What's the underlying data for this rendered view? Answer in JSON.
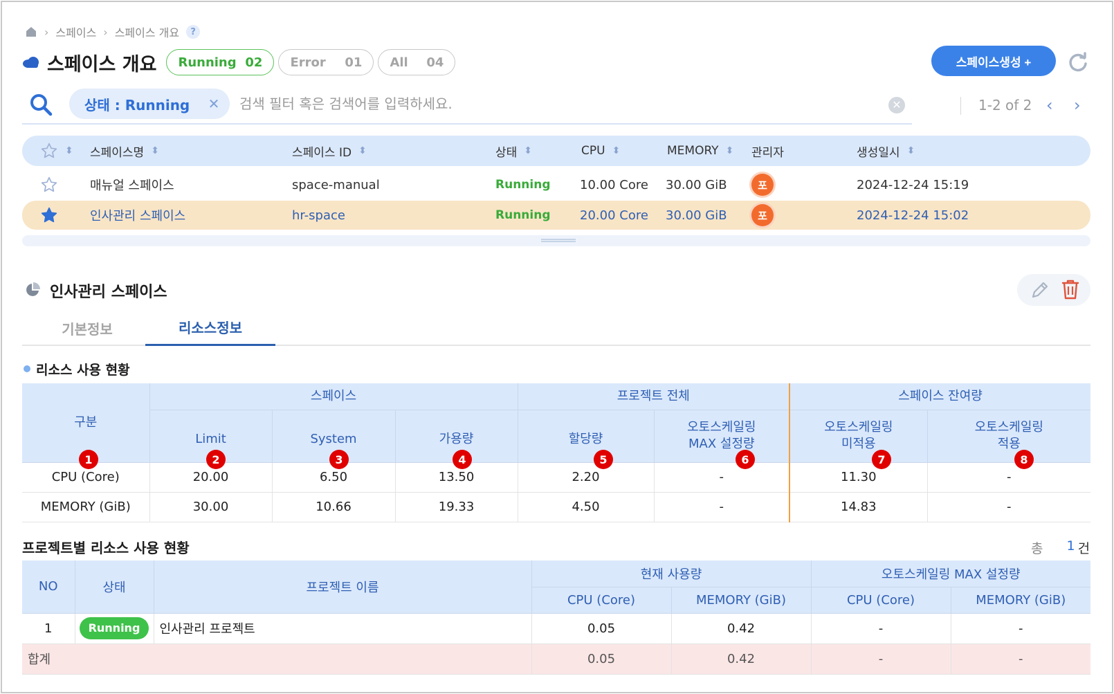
{
  "breadcrumb": {
    "item1": "스페이스",
    "item2": "스페이스 개요",
    "help": "?"
  },
  "header": {
    "title": "스페이스 개요",
    "pills": {
      "running": {
        "label": "Running",
        "count": "02"
      },
      "error": {
        "label": "Error",
        "count": "01"
      },
      "all": {
        "label": "All",
        "count": "04"
      }
    },
    "create_label": "스페이스생성 +"
  },
  "search": {
    "chip": "상태 : Running",
    "placeholder": "검색 필터 혹은 검색어를 입력하세요.",
    "pager": "1-2 of 2"
  },
  "list": {
    "columns": [
      "스페이스명",
      "스페이스 ID",
      "상태",
      "CPU",
      "MEMORY",
      "관리자",
      "생성일시"
    ],
    "rows": [
      {
        "name": "매뉴얼 스페이스",
        "id": "space-manual",
        "status": "Running",
        "cpu": "10.00 Core",
        "memory": "30.00 GiB",
        "admin": "포",
        "created": "2024-12-24 15:19",
        "starred": false
      },
      {
        "name": "인사관리 스페이스",
        "id": "hr-space",
        "status": "Running",
        "cpu": "20.00 Core",
        "memory": "30.00 GiB",
        "admin": "포",
        "created": "2024-12-24 15:02",
        "starred": true
      }
    ]
  },
  "detail": {
    "title": "인사관리 스페이스",
    "tabs": [
      "기본정보",
      "리소스정보"
    ]
  },
  "resource": {
    "section_title": "리소스 사용 현황",
    "group_headers": {
      "category": "구분",
      "space": "스페이스",
      "project_total": "프로젝트 전체",
      "space_remain": "스페이스 잔여량"
    },
    "sub_headers": {
      "limit": "Limit",
      "system": "System",
      "available": "가용량",
      "allocated": "할당량",
      "autoscale_max": "오토스케일링 MAX 설정량",
      "autoscale_unapplied": "오토스케일링 미적용",
      "autoscale_applied": "오토스케일링 적용"
    },
    "badges": [
      "1",
      "2",
      "3",
      "4",
      "5",
      "6",
      "7",
      "8"
    ],
    "rows": [
      {
        "label": "CPU (Core)",
        "limit": "20.00",
        "system": "6.50",
        "available": "13.50",
        "allocated": "2.20",
        "autoscale_max": "-",
        "unapplied": "11.30",
        "applied": "-"
      },
      {
        "label": "MEMORY (GiB)",
        "limit": "30.00",
        "system": "10.66",
        "available": "19.33",
        "allocated": "4.50",
        "autoscale_max": "-",
        "unapplied": "14.83",
        "applied": "-"
      }
    ]
  },
  "projects": {
    "title": "프로젝트별 리소스 사용 현황",
    "total_label": "총",
    "total_count": "1",
    "total_unit": "건",
    "headers": {
      "no": "NO",
      "status": "상태",
      "name": "프로젝트 이름",
      "current": "현재 사용량",
      "autoscale_max": "오토스케일링 MAX 설정량",
      "cpu": "CPU (Core)",
      "memory": "MEMORY (GiB)"
    },
    "rows": [
      {
        "no": "1",
        "status": "Running",
        "name": "인사관리 프로젝트",
        "cur_cpu": "0.05",
        "cur_mem": "0.42",
        "max_cpu": "-",
        "max_mem": "-"
      }
    ],
    "sum": {
      "label": "합계",
      "cur_cpu": "0.05",
      "cur_mem": "0.42",
      "max_cpu": "-",
      "max_mem": "-"
    }
  },
  "colors": {
    "accent": "#3b82e8",
    "running": "#3aab3a",
    "header_bg": "#dae8fb",
    "selected_row": "#f8e5c6",
    "badge": "#e00000"
  }
}
